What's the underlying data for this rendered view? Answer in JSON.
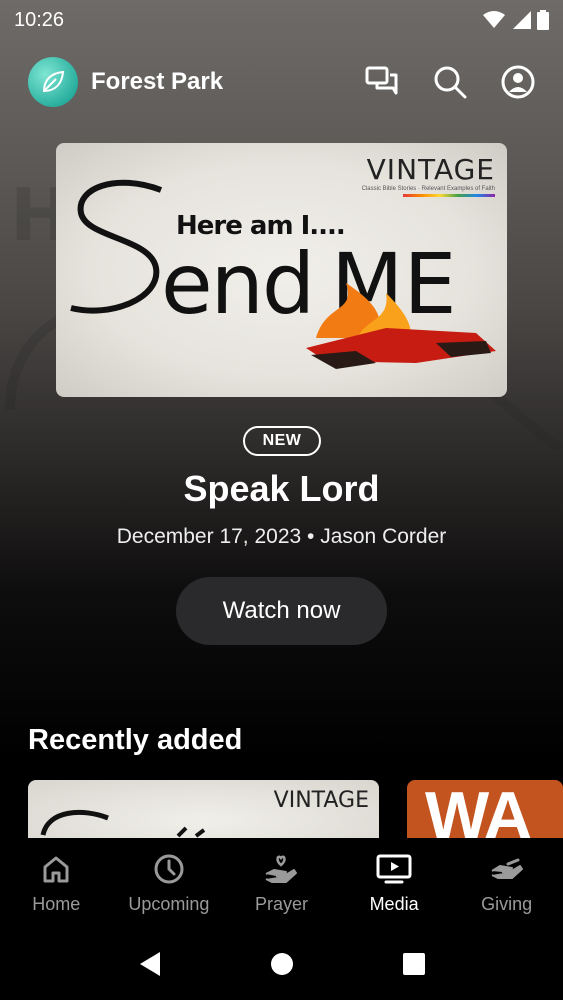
{
  "status_bar": {
    "time": "10:26",
    "icons": [
      "wifi-icon",
      "signal-icon",
      "battery-icon"
    ]
  },
  "header": {
    "org_name": "Forest Park",
    "actions": [
      "chat-icon",
      "search-icon",
      "account-icon"
    ]
  },
  "hero": {
    "artwork": {
      "brand": "VINTAGE",
      "tagline": "Classic Bible Stories · Relevant Examples of Faith",
      "line1": "Here am I....",
      "line2": "Send ME"
    },
    "badge": "NEW",
    "title": "Speak Lord",
    "meta": "December 17, 2023 • Jason Corder",
    "cta": "Watch now"
  },
  "recently_added": {
    "title": "Recently added",
    "items": [
      {
        "art_brand": "VINTAGE"
      },
      {
        "art_text": "WA"
      }
    ]
  },
  "bottom_nav": {
    "items": [
      {
        "label": "Home",
        "icon": "home-icon"
      },
      {
        "label": "Upcoming",
        "icon": "clock-icon"
      },
      {
        "label": "Prayer",
        "icon": "prayer-icon"
      },
      {
        "label": "Media",
        "icon": "media-icon",
        "active": true
      },
      {
        "label": "Giving",
        "icon": "giving-icon"
      }
    ]
  },
  "system_nav": [
    "back-icon",
    "home-circle-icon",
    "recents-icon"
  ],
  "colors": {
    "accent": "#2bb0a0",
    "button_bg": "#2a2a2c",
    "inactive": "#9a9a9a"
  }
}
